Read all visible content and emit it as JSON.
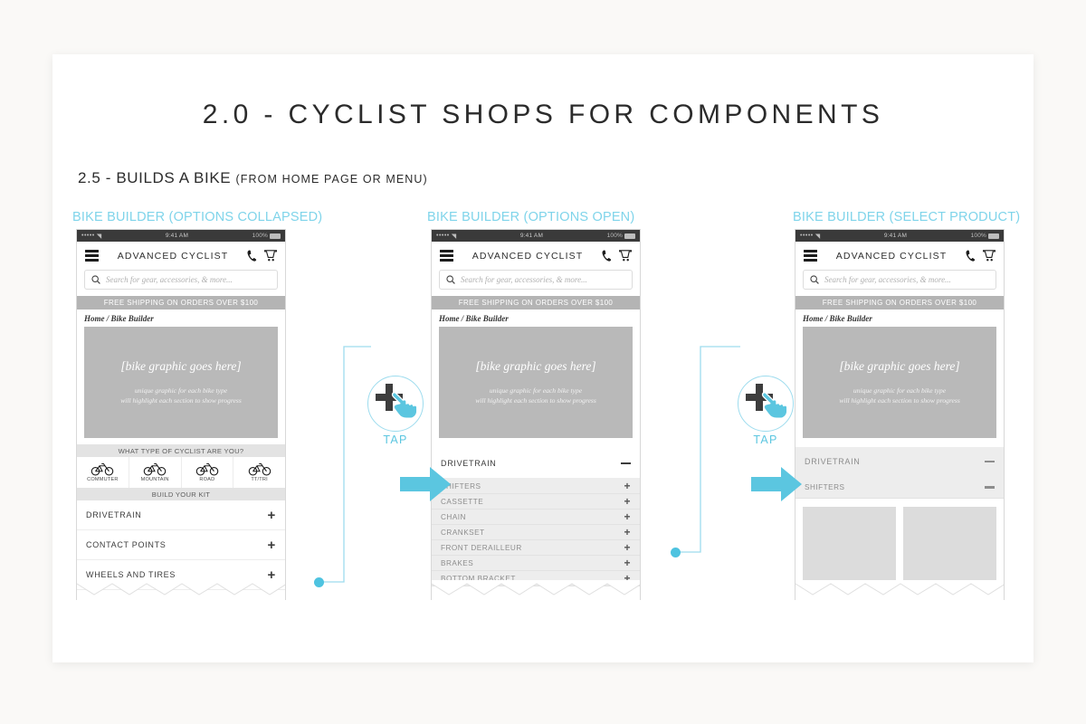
{
  "page": {
    "title": "2.0 - CYCLIST SHOPS FOR COMPONENTS",
    "section_number": "2.5 - BUILDS A BIKE ",
    "section_note": "(from home page or menu)",
    "background_color": "#faf9f7",
    "accent_color": "#4ec3e0",
    "label_color": "#7fd4ea"
  },
  "columns": [
    {
      "label": "BIKE BUILDER (OPTIONS COLLAPSED)"
    },
    {
      "label": "BIKE BUILDER (OPTIONS OPEN)"
    },
    {
      "label": "BIKE BUILDER (SELECT PRODUCT)"
    }
  ],
  "phone_chrome": {
    "status_dots": "•••••",
    "status_wifi": "◥",
    "status_time": "9:41 AM",
    "status_battery_text": "100%",
    "brand": "ADVANCED CYCLIST",
    "search_placeholder": "Search for gear, accessories, & more...",
    "shipping_banner": "FREE SHIPPING ON ORDERS OVER $100",
    "breadcrumb": "Home / Bike Builder",
    "hero_main": "[bike graphic goes here]",
    "hero_sub_line1": "unique graphic for each bike type",
    "hero_sub_line2": "will highlight each section to show progress",
    "icons": {
      "menu": "hamburger-icon",
      "phone": "phone-icon",
      "cart": "cart-icon",
      "search": "search-icon"
    }
  },
  "cyclist_types": {
    "heading": "WHAT TYPE OF CYCLIST ARE YOU?",
    "kit_heading": "BUILD YOUR KIT",
    "options": [
      {
        "label": "COMMUTER",
        "icon": "bicycle-icon"
      },
      {
        "label": "MOUNTAIN",
        "icon": "bicycle-icon"
      },
      {
        "label": "ROAD",
        "icon": "bicycle-icon"
      },
      {
        "label": "TT/TRI",
        "icon": "bicycle-icon"
      }
    ]
  },
  "screen1": {
    "accordion": [
      {
        "label": "DRIVETRAIN",
        "control": "dot"
      },
      {
        "label": "CONTACT POINTS",
        "control": "plus"
      },
      {
        "label": "WHEELS AND TIRES",
        "control": "plus"
      }
    ]
  },
  "screen2": {
    "accordion_open": {
      "label": "DRIVETRAIN",
      "control": "minus"
    },
    "sub_items": [
      {
        "label": "SHIFTERS",
        "control": "plus"
      },
      {
        "label": "CASSETTE",
        "control": "plus"
      },
      {
        "label": "CHAIN",
        "control": "plus"
      },
      {
        "label": "CRANKSET",
        "control": "plus"
      },
      {
        "label": "FRONT DERAILLEUR",
        "control": "plus"
      },
      {
        "label": "BRAKES",
        "control": "plus"
      },
      {
        "label": "BOTTOM BRACKET",
        "control": "plus"
      }
    ]
  },
  "screen3": {
    "accordion_open": {
      "label": "DRIVETRAIN",
      "control": "minus"
    },
    "sub_open": {
      "label": "SHIFTERS",
      "control": "minus"
    },
    "product_tiles": [
      {
        "label": ""
      },
      {
        "label": ""
      }
    ]
  },
  "annotations": {
    "tap_label": "TAP",
    "tap_icon": "plus-with-hand-cursor-icon",
    "arrow_icon": "right-arrow-icon"
  }
}
